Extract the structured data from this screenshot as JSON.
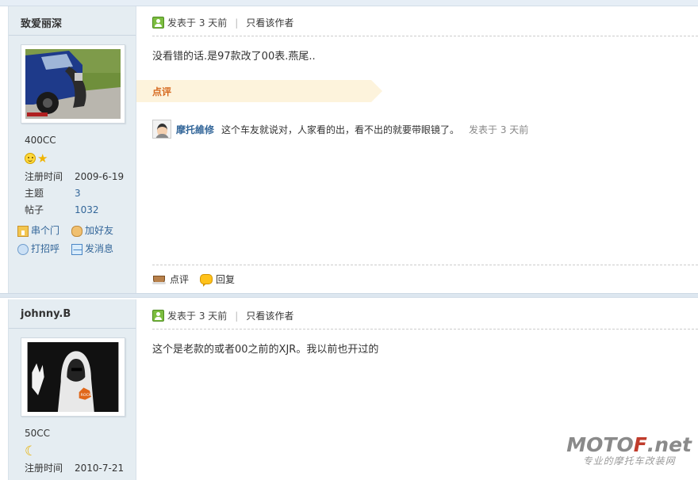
{
  "posts": [
    {
      "username": "致爱丽深",
      "rank": "400CC",
      "info": {
        "reg_label": "注册时间",
        "reg_value": "2009-6-19",
        "topics_label": "主题",
        "topics_value": "3",
        "posts_label": "帖子",
        "posts_value": "1032"
      },
      "actions": {
        "visit": "串个门",
        "add_friend": "加好友",
        "greet": "打招呼",
        "message": "发消息"
      },
      "meta": {
        "posted": "发表于 3 天前",
        "only_author": "只看该作者"
      },
      "message": "没看错的话.是97款改了00表.燕尾..",
      "dianping_label": "点评",
      "comment": {
        "author": "摩托維修",
        "text": "这个车友就说对，人家看的出，看不出的就要带眼镜了。",
        "time": "发表于 3 天前"
      },
      "footer": {
        "comment": "点评",
        "reply": "回复"
      }
    },
    {
      "username": "johnny.B",
      "rank": "50CC",
      "info": {
        "reg_label": "注册时间",
        "reg_value": "2010-7-21"
      },
      "meta": {
        "posted": "发表于 3 天前",
        "only_author": "只看该作者"
      },
      "message": "这个是老款的或者00之前的XJR。我以前也开过的"
    }
  ],
  "watermark": {
    "brand_a": "MOTO",
    "brand_b": "F",
    "brand_c": ".net",
    "slogan": "专业的摩托车改装网"
  }
}
